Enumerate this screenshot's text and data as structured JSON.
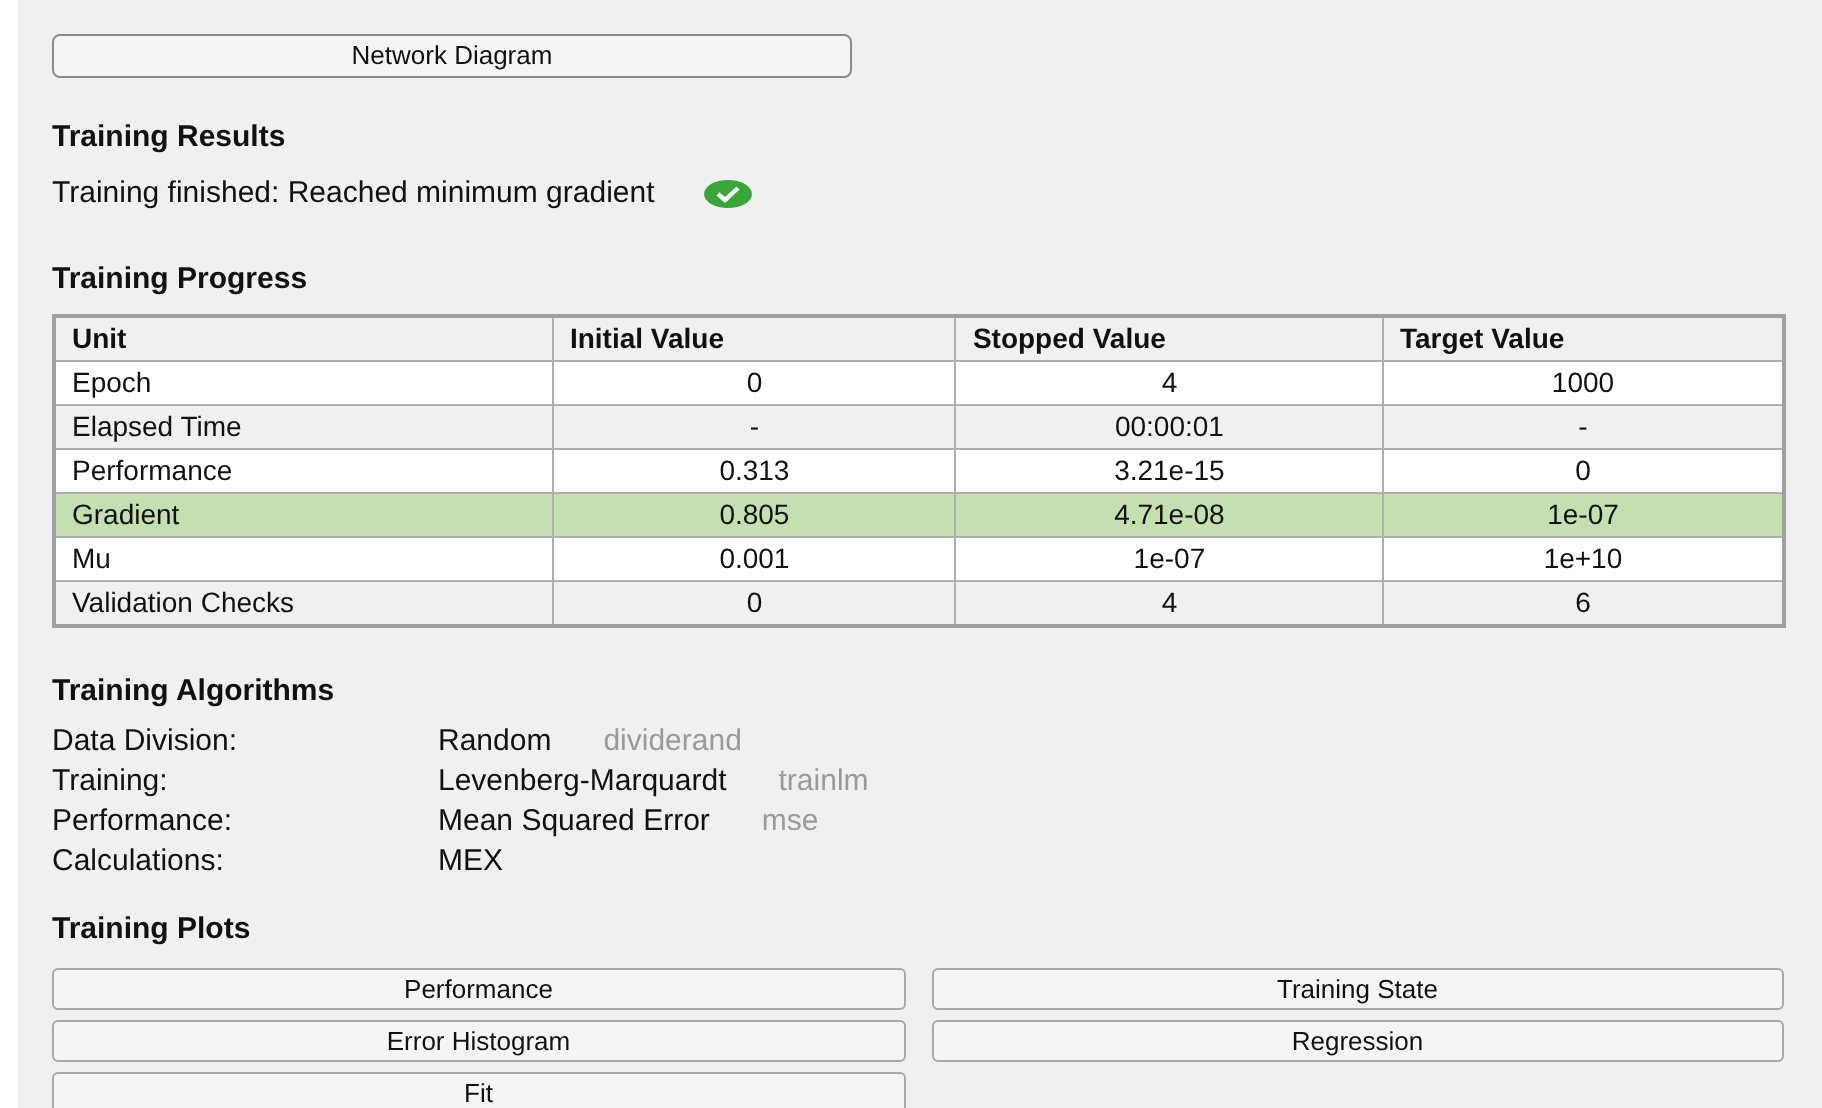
{
  "network_button": "Network Diagram",
  "results": {
    "title": "Training Results",
    "message": "Training finished: Reached minimum gradient",
    "succeeded": true
  },
  "progress": {
    "title": "Training Progress",
    "columns": [
      "Unit",
      "Initial Value",
      "Stopped Value",
      "Target Value"
    ],
    "rows": [
      {
        "cells": [
          "Epoch",
          "0",
          "4",
          "1000"
        ],
        "highlighted": false
      },
      {
        "cells": [
          "Elapsed Time",
          "-",
          "00:00:01",
          "-"
        ],
        "highlighted": false
      },
      {
        "cells": [
          "Performance",
          "0.313",
          "3.21e-15",
          "0"
        ],
        "highlighted": false
      },
      {
        "cells": [
          "Gradient",
          "0.805",
          "4.71e-08",
          "1e-07"
        ],
        "highlighted": true
      },
      {
        "cells": [
          "Mu",
          "0.001",
          "1e-07",
          "1e+10"
        ],
        "highlighted": false
      },
      {
        "cells": [
          "Validation Checks",
          "0",
          "4",
          "6"
        ],
        "highlighted": false
      }
    ]
  },
  "algorithms": {
    "title": "Training Algorithms",
    "items": [
      {
        "label": "Data Division:",
        "value": "Random",
        "function": "dividerand"
      },
      {
        "label": "Training:",
        "value": "Levenberg-Marquardt",
        "function": "trainlm"
      },
      {
        "label": "Performance:",
        "value": "Mean Squared Error",
        "function": "mse"
      },
      {
        "label": "Calculations:",
        "value": "MEX"
      }
    ]
  },
  "plots": {
    "title": "Training Plots",
    "buttons": [
      "Performance",
      "Training State",
      "Error Histogram",
      "Regression",
      "Fit"
    ]
  }
}
